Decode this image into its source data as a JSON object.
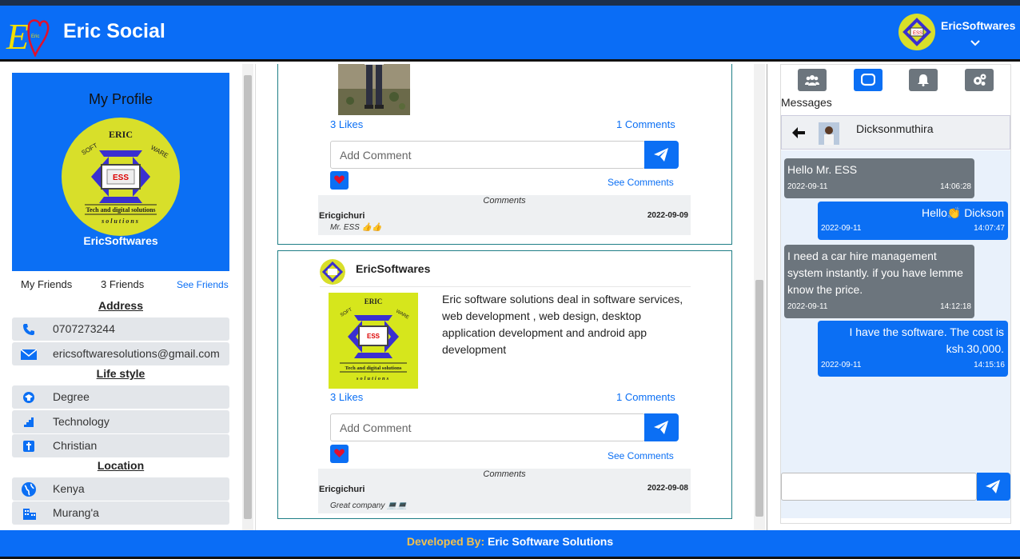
{
  "header": {
    "app_title": "Eric Social",
    "username": "EricSoftwares",
    "logo_icon": "eric-ev-heart-logo",
    "dropdown_icon": "chevron-down-icon"
  },
  "profile": {
    "title": "My Profile",
    "name": "EricSoftwares",
    "logo_top": "ERIC",
    "logo_left": "SOFT",
    "logo_right": "WARE",
    "logo_center": "ESS",
    "logo_line1": "Tech and digital solutions",
    "logo_line2": "solutions",
    "friends_label": "My Friends",
    "friends_count": "3 Friends",
    "see_friends": "See Friends",
    "address_head": "Address",
    "phone": "0707273244",
    "email": "ericsoftwaresolutions@gmail.com",
    "lifestyle_head": "Life style",
    "education": "Degree",
    "career": "Technology",
    "religion": "Christian",
    "location_head": "Location",
    "country": "Kenya",
    "county": "Murang'a"
  },
  "feed": {
    "posts": [
      {
        "likes": "3 Likes",
        "comments_count": "1 Comments",
        "add_comment_placeholder": "Add Comment",
        "see_comments": "See Comments",
        "comments_head": "Comments",
        "comment_author": "Ericgichuri",
        "comment_date": "2022-09-09",
        "comment_text": "Mr. ESS 👍👍"
      },
      {
        "author": "EricSoftwares",
        "text": "Eric software solutions deal in software services, web development , web design, desktop application development and android app development",
        "likes": "3 Likes",
        "comments_count": "1 Comments",
        "add_comment_placeholder": "Add Comment",
        "see_comments": "See Comments",
        "comments_head": "Comments",
        "comment_author": "Ericgichuri",
        "comment_date": "2022-09-08",
        "comment_text": "Great company 💻💻"
      }
    ]
  },
  "chat": {
    "messages_head": "Messages",
    "contact": "Dicksonmuthira",
    "messages": [
      {
        "dir": "in",
        "text": "Hello Mr. ESS",
        "date": "2022-09-11",
        "time": "14:06:28"
      },
      {
        "dir": "out",
        "text": "Hello👏 Dickson",
        "date": "2022-09-11",
        "time": "14:07:47"
      },
      {
        "dir": "in",
        "text": "I need a car hire management system instantly. if you have lemme know the price.",
        "date": "2022-09-11",
        "time": "14:12:18"
      },
      {
        "dir": "out",
        "text": "I have the software. The cost is ksh.30,000.",
        "date": "2022-09-11",
        "time": "14:15:16"
      }
    ]
  },
  "footer": {
    "label": "Developed By:",
    "value": "Eric Software Solutions"
  },
  "colors": {
    "primary": "#0a6df6",
    "secondary": "#6c757d",
    "logo_yellow": "#d8df2a",
    "heart": "#e0102d"
  }
}
